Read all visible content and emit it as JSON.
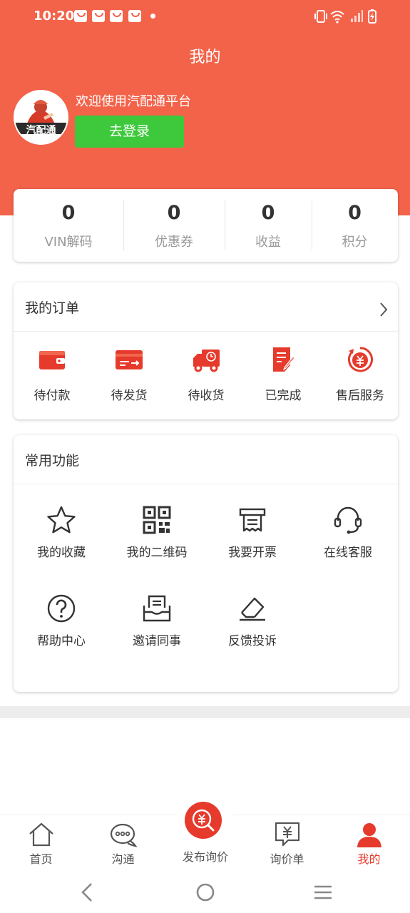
{
  "status_bar": {
    "time": "10:20"
  },
  "header": {
    "title": "我的"
  },
  "profile": {
    "welcome_text": "欢迎使用汽配通平台",
    "login_button": "去登录",
    "logo_text": "汽配通"
  },
  "stats": [
    {
      "value": "0",
      "label": "VIN解码"
    },
    {
      "value": "0",
      "label": "优惠券"
    },
    {
      "value": "0",
      "label": "收益"
    },
    {
      "value": "0",
      "label": "积分"
    }
  ],
  "orders": {
    "title": "我的订单",
    "items": [
      {
        "label": "待付款",
        "icon": "wallet-icon"
      },
      {
        "label": "待发货",
        "icon": "card-send-icon"
      },
      {
        "label": "待收货",
        "icon": "truck-icon"
      },
      {
        "label": "已完成",
        "icon": "document-edit-icon"
      },
      {
        "label": "售后服务",
        "icon": "yen-refund-icon"
      }
    ]
  },
  "functions": {
    "title": "常用功能",
    "items": [
      {
        "label": "我的收藏",
        "icon": "star-icon"
      },
      {
        "label": "我的二维码",
        "icon": "qr-code-icon"
      },
      {
        "label": "我要开票",
        "icon": "receipt-icon"
      },
      {
        "label": "在线客服",
        "icon": "headset-icon"
      },
      {
        "label": "帮助中心",
        "icon": "help-icon"
      },
      {
        "label": "邀请同事",
        "icon": "mail-icon"
      },
      {
        "label": "反馈投诉",
        "icon": "eraser-icon"
      }
    ]
  },
  "tabbar": {
    "items": [
      {
        "label": "首页",
        "icon": "home-icon"
      },
      {
        "label": "沟通",
        "icon": "chat-icon"
      },
      {
        "label": "发布询价",
        "icon": "yen-search-icon"
      },
      {
        "label": "询价单",
        "icon": "yen-message-icon"
      },
      {
        "label": "我的",
        "icon": "user-icon",
        "active": true
      }
    ]
  },
  "colors": {
    "header": "#f3634a",
    "login_button": "#3ec93c",
    "accent": "#e53a2c"
  }
}
